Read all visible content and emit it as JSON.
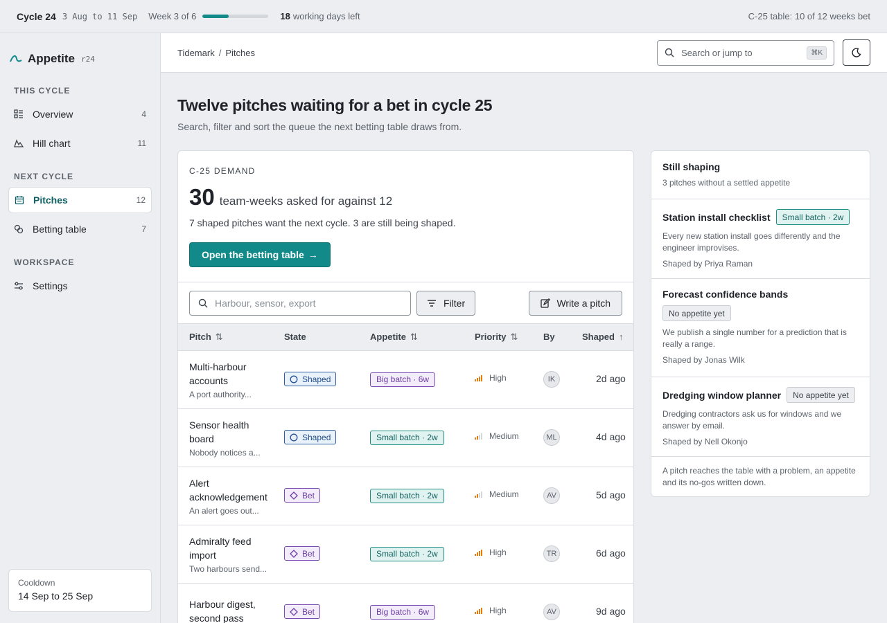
{
  "topbar": {
    "cycle": "Cycle 24",
    "dates": "3 Aug to 11 Sep",
    "week": "Week 3 of 6",
    "progress": 0.4,
    "days_num": "18",
    "days_text": "working days left",
    "bet_status": "C-25 table: 10 of 12 weeks bet"
  },
  "sidebar": {
    "brand": "Appetite",
    "brand_tag": "r24",
    "sections": [
      {
        "label": "THIS CYCLE"
      },
      {
        "label": "NEXT CYCLE"
      },
      {
        "label": "WORKSPACE"
      }
    ],
    "items": [
      {
        "label": "Overview",
        "count": "4"
      },
      {
        "label": "Hill chart",
        "count": "11"
      },
      {
        "label": "Pitches",
        "count": "12"
      },
      {
        "label": "Betting table",
        "count": "7"
      },
      {
        "label": "Settings",
        "count": ""
      }
    ],
    "cooldown_label": "Cooldown",
    "cooldown_value": "14 Sep to 25 Sep"
  },
  "header": {
    "crumb_root": "Tidemark",
    "crumb_sep": "/",
    "crumb_page": "Pitches",
    "search_placeholder": "Search or jump to",
    "search_shortcut": "⌘K"
  },
  "main": {
    "title": "Twelve pitches waiting for a bet in cycle 25",
    "subtitle": "Search, filter and sort the queue the next betting table draws from."
  },
  "demand": {
    "eyebrow": "C-25 DEMAND",
    "big": "30",
    "big_text": "team-weeks asked for against 12",
    "desc": "7 shaped pitches want the next cycle. 3 are still being shaped.",
    "cta": "Open the betting table",
    "cta_arrow": "→"
  },
  "toolbar": {
    "filter_placeholder": "Harbour, sensor, export",
    "filter_button": "Filter",
    "write_button": "Write a pitch"
  },
  "table": {
    "columns": [
      "Pitch",
      "State",
      "Appetite",
      "Priority",
      "By",
      "Shaped"
    ],
    "sort_glyph": "⇅",
    "sort_up_glyph": "↑",
    "rows": [
      {
        "title": "Multi-harbour accounts",
        "sub": "A port authority...",
        "state": "Shaped",
        "appetite": "Big batch · 6w",
        "priority": "High",
        "by": "IK",
        "shaped": "2d ago"
      },
      {
        "title": "Sensor health board",
        "sub": "Nobody notices a...",
        "state": "Shaped",
        "appetite": "Small batch · 2w",
        "priority": "Medium",
        "by": "ML",
        "shaped": "4d ago"
      },
      {
        "title": "Alert acknowledgement",
        "sub": "An alert goes out...",
        "state": "Bet",
        "appetite": "Small batch · 2w",
        "priority": "Medium",
        "by": "AV",
        "shaped": "5d ago"
      },
      {
        "title": "Admiralty feed import",
        "sub": "Two harbours send...",
        "state": "Bet",
        "appetite": "Small batch · 2w",
        "priority": "High",
        "by": "TR",
        "shaped": "6d ago"
      },
      {
        "title": "Harbour digest, second pass",
        "sub": "",
        "state": "Bet",
        "appetite": "Big batch · 6w",
        "priority": "High",
        "by": "AV",
        "shaped": "9d ago"
      }
    ]
  },
  "side": {
    "title": "Still shaping",
    "subtitle": "3 pitches without a settled appetite",
    "items": [
      {
        "title": "Station install checklist",
        "badge": "Small batch · 2w",
        "desc": "Every new station install goes differently and the engineer improvises.",
        "by": "Shaped by Priya Raman"
      },
      {
        "title": "Forecast confidence bands",
        "badge": "No appetite yet",
        "desc": "We publish a single number for a prediction that is really a range.",
        "by": "Shaped by Jonas Wilk"
      },
      {
        "title": "Dredging window planner",
        "badge": "No appetite yet",
        "desc": "Dredging contractors ask us for windows and we answer by email.",
        "by": "Shaped by Nell Okonjo"
      }
    ],
    "footer": "A pitch reaches the table with a problem, an appetite and its no-gos written down."
  },
  "colors": {
    "accent": "#128a8a",
    "shaped": "#2f5ea0",
    "bet": "#7a4bb0",
    "small_batch": "#1f8c86",
    "priority_bar": "#e07b12"
  },
  "icons": {
    "logo": "wave-logo-icon",
    "overview": "grid-list-icon",
    "hill": "mountain-icon",
    "pitches": "calendar-icon",
    "betting": "chips-icon",
    "settings": "sliders-icon",
    "search": "search-icon",
    "theme": "moon-icon",
    "filter": "filter-lines-icon",
    "write": "pencil-square-icon",
    "shaped_state": "circle-icon",
    "bet_state": "diamond-icon",
    "priority": "signal-bars-icon"
  }
}
